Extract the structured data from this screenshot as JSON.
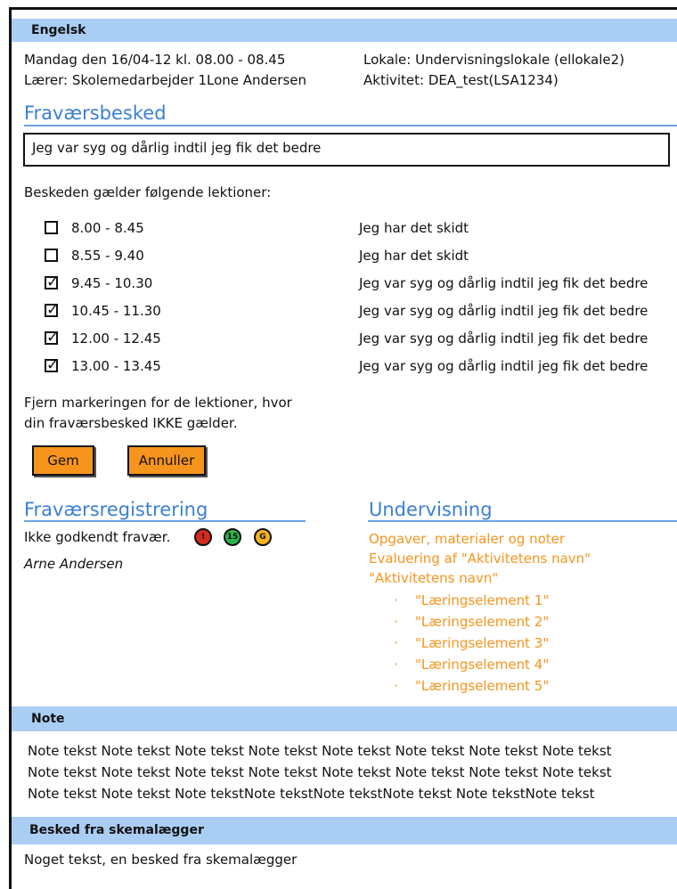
{
  "header": {
    "title": "Engelsk"
  },
  "info": {
    "date_line": "Mandag den 16/04-12 kl. 08.00 - 08.45",
    "teacher_line": "Lærer: Skolemedarbejder 1Lone Andersen",
    "room_line": "Lokale: Undervisningslokale (ellokale2)",
    "activity_line": "Aktivitet: DEA_test(LSA1234)"
  },
  "absence_message": {
    "heading": "Fraværsbesked",
    "value": "Jeg var syg og dårlig indtil jeg fik det bedre"
  },
  "lessons": {
    "intro": "Beskeden gælder følgende lektioner:",
    "items": [
      {
        "time": "8.00 - 8.45",
        "message": "Jeg har det skidt",
        "checked": false
      },
      {
        "time": "8.55 - 9.40",
        "message": "Jeg har det skidt",
        "checked": false
      },
      {
        "time": "9.45 - 10.30",
        "message": "Jeg var syg og dårlig indtil jeg fik det bedre",
        "checked": true
      },
      {
        "time": "10.45 - 11.30",
        "message": "Jeg var syg og dårlig indtil jeg fik det bedre",
        "checked": true
      },
      {
        "time": "12.00 - 12.45",
        "message": "Jeg var syg og dårlig indtil jeg fik det bedre",
        "checked": true
      },
      {
        "time": "13.00 - 13.45",
        "message": "Jeg var syg og dårlig indtil jeg fik det bedre",
        "checked": true
      }
    ],
    "hint_line1": "Fjern markeringen for de lektioner, hvor",
    "hint_line2": "din fraværsbesked IKKE gælder."
  },
  "buttons": {
    "save": "Gem",
    "cancel": "Annuller"
  },
  "registration": {
    "heading": "Fraværsregistrering",
    "status": "Ikke godkendt fravær.",
    "badges": [
      {
        "text": "!",
        "color": "#d42a1f"
      },
      {
        "text": "15",
        "color": "#2bb34a"
      },
      {
        "text": "G",
        "color": "#f7b21d"
      }
    ],
    "student": "Arne Andersen"
  },
  "teaching": {
    "heading": "Undervisning",
    "links": [
      "Opgaver, materialer og noter",
      "Evaluering af \"Aktivitetens navn\"",
      "\"Aktivitetens navn\""
    ],
    "elements": [
      "\"Læringselement 1\"",
      "\"Læringselement 2\"",
      "\"Læringselement 3\"",
      "\"Læringselement 4\"",
      "\"Læringselement 5\""
    ]
  },
  "note": {
    "title": "Note",
    "lines": [
      "Note tekst Note tekst Note tekst Note tekst Note tekst Note tekst Note tekst Note tekst",
      "Note tekst Note tekst Note tekst Note tekst Note tekst Note tekst Note tekst Note tekst",
      "Note tekst Note tekst  Note tekstNote tekstNote tekstNote tekst Note tekstNote tekst"
    ]
  },
  "scheduler": {
    "title": "Besked fra skemalægger",
    "message": "Noget tekst, en besked fra skemalægger"
  },
  "colors": {
    "accent": "#3b7fd3",
    "bar": "#a9cdf3",
    "button": "#f7941d"
  }
}
